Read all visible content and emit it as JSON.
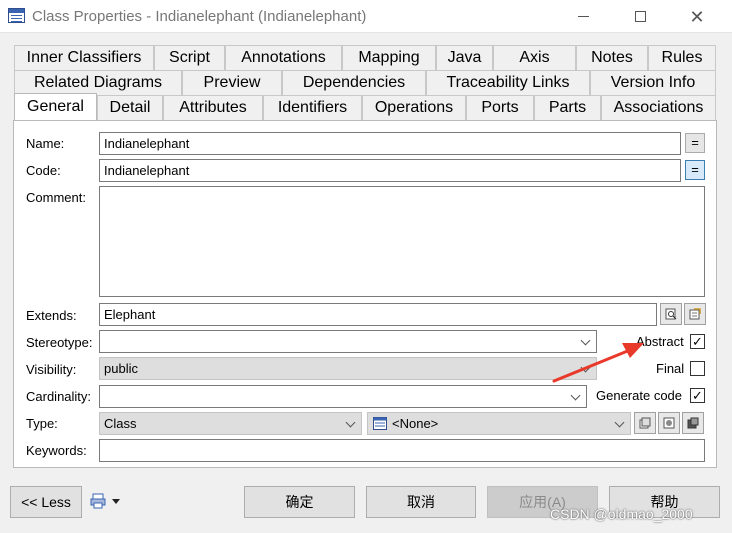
{
  "window": {
    "title": "Class Properties - Indianelephant (Indianelephant)"
  },
  "tabs": {
    "row1": [
      "Inner Classifiers",
      "Script",
      "Annotations",
      "Mapping",
      "Java",
      "Axis",
      "Notes",
      "Rules"
    ],
    "row2": [
      "Related Diagrams",
      "Preview",
      "Dependencies",
      "Traceability Links",
      "Version Info"
    ],
    "row3": [
      "General",
      "Detail",
      "Attributes",
      "Identifiers",
      "Operations",
      "Ports",
      "Parts",
      "Associations"
    ],
    "active": "General"
  },
  "form": {
    "name_label": "Name:",
    "name_value": "Indianelephant",
    "code_label": "Code:",
    "code_value": "Indianelephant",
    "comment_label": "Comment:",
    "comment_value": "",
    "extends_label": "Extends:",
    "extends_value": "Elephant",
    "stereotype_label": "Stereotype:",
    "stereotype_value": "",
    "visibility_label": "Visibility:",
    "visibility_value": "public",
    "cardinality_label": "Cardinality:",
    "cardinality_value": "",
    "type_label": "Type:",
    "type_value": "Class",
    "type_ref_value": "<None>",
    "keywords_label": "Keywords:",
    "keywords_value": "",
    "eq_label": "="
  },
  "options": {
    "abstract_label": "Abstract",
    "abstract_checked": true,
    "final_label": "Final",
    "final_checked": false,
    "generate_code_label": "Generate code",
    "generate_code_checked": true
  },
  "buttons": {
    "less": "<< Less",
    "ok": "确定",
    "cancel": "取消",
    "apply": "应用(A)",
    "help": "帮助"
  },
  "watermark": "CSDN @oldmao_2000",
  "colors": {
    "annotation_arrow": "#e8392a",
    "focus_border": "#0078d7"
  }
}
